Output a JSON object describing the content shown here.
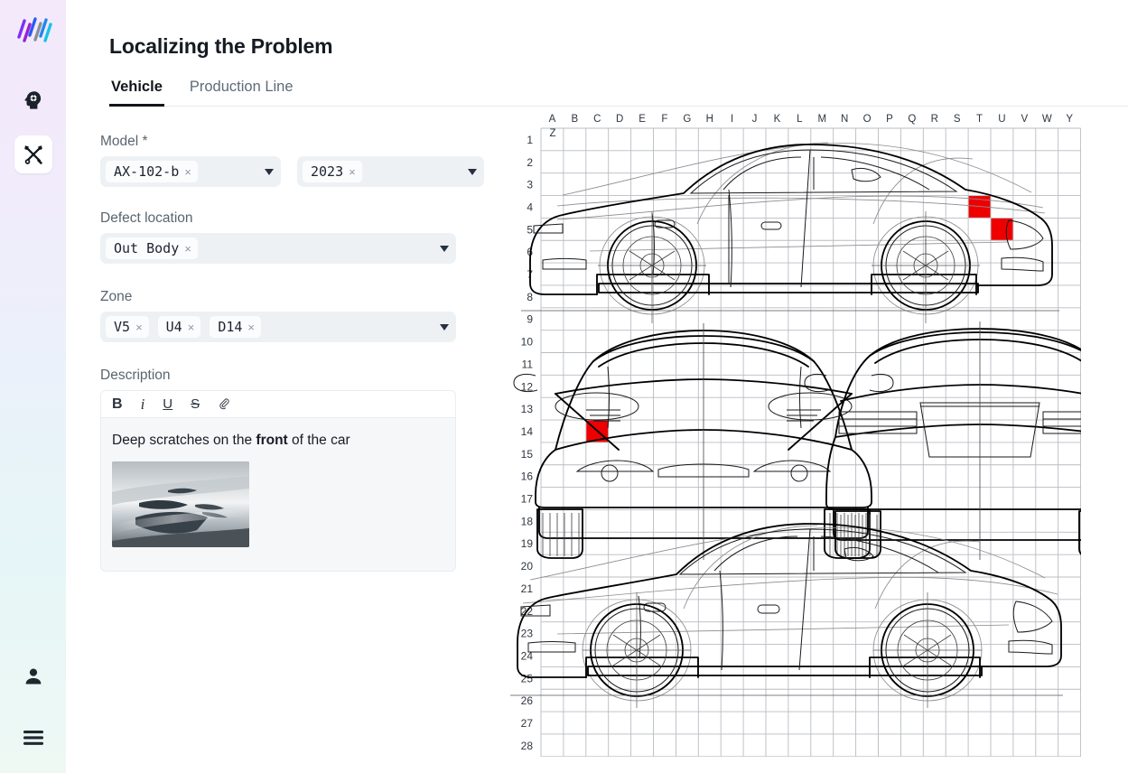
{
  "app": {
    "logo_name": "brand-logo"
  },
  "sidebar": {
    "items": [
      {
        "name": "ai-assistant-icon",
        "label": "AI Assistant",
        "active": false
      },
      {
        "name": "tools-icon",
        "label": "Tools",
        "active": true
      }
    ],
    "bottom_items": [
      {
        "name": "user-account-icon",
        "label": "Account"
      },
      {
        "name": "menu-icon",
        "label": "Menu"
      }
    ]
  },
  "header": {
    "title": "Localizing the Problem"
  },
  "tabs": [
    {
      "label": "Vehicle",
      "active": true
    },
    {
      "label": "Production Line",
      "active": false
    }
  ],
  "form": {
    "model": {
      "label": "Model",
      "required_marker": "*",
      "chips": [
        "AX-102-b"
      ],
      "year_chips": [
        "2023"
      ],
      "remove_glyph": "×"
    },
    "defect_location": {
      "label": "Defect location",
      "chips": [
        "Out Body"
      ]
    },
    "zone": {
      "label": "Zone",
      "chips": [
        "V5",
        "U4",
        "D14"
      ]
    },
    "description": {
      "label": "Description",
      "toolbar": [
        {
          "name": "bold-icon",
          "glyph": "B"
        },
        {
          "name": "italic-icon",
          "glyph": "i"
        },
        {
          "name": "underline-icon",
          "glyph": "U"
        },
        {
          "name": "strikethrough-icon",
          "glyph": "S"
        },
        {
          "name": "attachment-icon",
          "glyph": "📎"
        }
      ],
      "text_before": "Deep scratches on the ",
      "text_bold": "front",
      "text_after": " of the car",
      "attachment_name": "defect-photo-thumbnail"
    }
  },
  "diagram": {
    "column_labels": [
      "A",
      "B",
      "C",
      "D",
      "E",
      "F",
      "G",
      "H",
      "I",
      "J",
      "K",
      "L",
      "M",
      "N",
      "O",
      "P",
      "Q",
      "R",
      "S",
      "T",
      "U",
      "V",
      "W",
      "Y"
    ],
    "corner_label": "Z",
    "row_labels": [
      "1",
      "2",
      "3",
      "4",
      "5",
      "6",
      "7",
      "8",
      "9",
      "10",
      "11",
      "12",
      "13",
      "14",
      "15",
      "16",
      "17",
      "18",
      "19",
      "20",
      "21",
      "22",
      "23",
      "24",
      "25",
      "26",
      "27",
      "28"
    ],
    "views": [
      {
        "name": "side-view-top",
        "label": "Side view"
      },
      {
        "name": "front-view",
        "label": "Front view"
      },
      {
        "name": "rear-view",
        "label": "Rear view"
      },
      {
        "name": "side-view-bottom",
        "label": "Side view"
      }
    ],
    "highlight_color": "#ee0000",
    "grid_color": "#b8bcc2",
    "highlights": [
      {
        "col": "T",
        "row": "4",
        "view": "side-view-top"
      },
      {
        "col": "U",
        "row": "5",
        "view": "side-view-top"
      },
      {
        "col": "C",
        "row": "14",
        "view": "front-view"
      }
    ]
  },
  "colors": {
    "accent": "#12161c",
    "field_bg": "#eef1f4",
    "label": "#59656f",
    "highlight": "#ee0000"
  }
}
